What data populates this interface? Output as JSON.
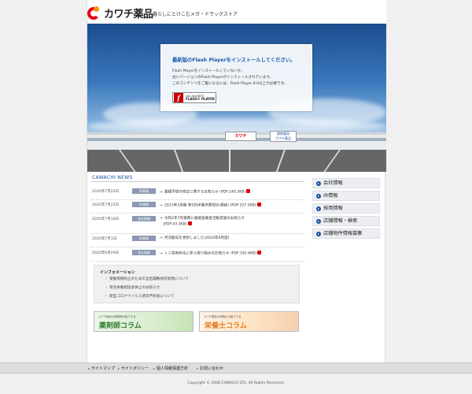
{
  "header": {
    "logo_text": "カワチ薬品",
    "tagline": "暮らしにとけこむメガ・ドラッグストア"
  },
  "hero": {
    "store_sign_main": "カワチ",
    "store_sign_sub_1": "調剤薬局",
    "store_sign_sub_2": "カワチ薬品",
    "flash": {
      "title": "最新版のFlash Playerをインストールしてください。",
      "lines": [
        "Flash Playerをインストールしていないか、",
        "古いバージョンのFlash Playerがインストールされています。",
        "このコンテンツをご覧になるには、Flash Player 8.0以上が必要です。"
      ],
      "button_small": "Get ADOBE®",
      "button_big": "FLASH® PLAYER"
    }
  },
  "news": {
    "title": "CAWACHI NEWS",
    "items": [
      {
        "date": "2020年7月22日",
        "badge": "IR情報",
        "text": "業績予想の修正に関するお知らせ",
        "pdf": "(PDF:140.5KB)"
      },
      {
        "date": "2020年7月22日",
        "badge": "IR情報",
        "text": "2021年3月期 第1四半期決算短信(連結)",
        "pdf": "(PDF:257.0KB)"
      },
      {
        "date": "2020年7月16日",
        "badge": "会社情報",
        "text": "令和2年7月豪雨に義援金募金活動実施のお知らせ",
        "pdf": "(PDF:43.3KB)"
      },
      {
        "date": "2020年7月1日",
        "badge": "IR情報",
        "text": "月次動向を更新しました(2020年6月度)",
        "pdf": ""
      },
      {
        "date": "2020年6月29日",
        "badge": "会社情報",
        "text": "レジ袋有料化に伴う取り組みのお知らせ",
        "pdf": "(PDF:192.6KB)"
      }
    ]
  },
  "info": {
    "title": "インフォメーション",
    "items": [
      "受動喫煙防止のための全店舗敷地内禁煙について",
      "育児栄養相談会休止のお知らせ",
      "新型コロナウイルス感染予防策について"
    ]
  },
  "banners": [
    {
      "sub": "カワチ薬品の薬剤師が紹介する",
      "title": "薬剤師コラム"
    },
    {
      "sub": "カワチ薬品の栄養士が紹介する",
      "title": "栄養士コラム"
    }
  ],
  "sidebar": {
    "items": [
      {
        "label": "会社情報"
      },
      {
        "label": "IR情報"
      },
      {
        "label": "採用情報"
      },
      {
        "label": "店舗情報・検索"
      },
      {
        "label": "店舗物件情報募集"
      }
    ]
  },
  "footer": {
    "nav": [
      "サイトマップ",
      "サイトポリシー",
      "個人情報保護方針",
      "お問い合わせ"
    ],
    "copyright": "Copyright © 2008 CAWACHI LTD. All Rights Reserved."
  },
  "colors": {
    "brand_red": "#e60012",
    "brand_orange": "#f39800",
    "link_blue": "#1a4fa0",
    "badge_gray": "#8c99b0"
  },
  "icons": {
    "news_arrow": "arrow-right-icon",
    "pdf": "pdf-icon",
    "sidebar_bullet": "circle-arrow-icon",
    "flash": "flash-player-icon"
  }
}
